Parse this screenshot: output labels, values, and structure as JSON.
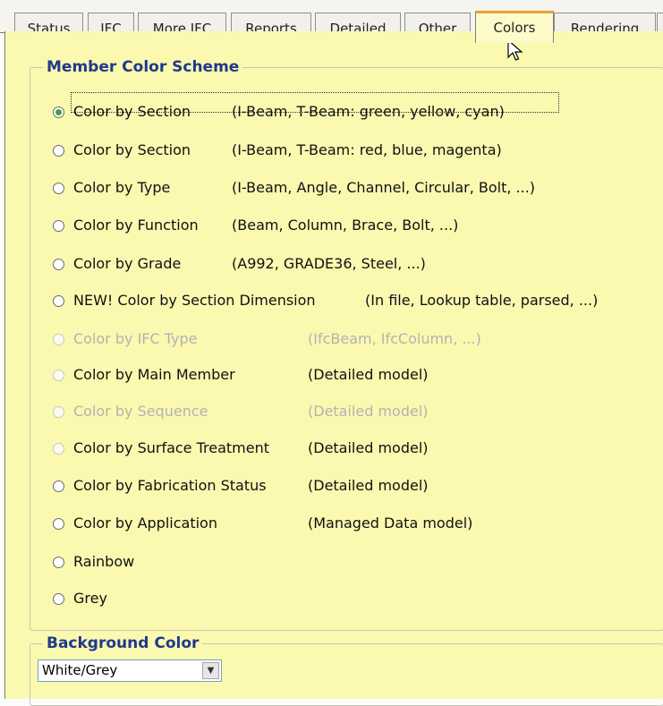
{
  "tabs": [
    {
      "label": "Status"
    },
    {
      "label": "IFC"
    },
    {
      "label": "More IFC"
    },
    {
      "label": "Reports"
    },
    {
      "label": "Detailed"
    },
    {
      "label": "Other"
    },
    {
      "label": "Colors",
      "active": true
    },
    {
      "label": "Rendering"
    }
  ],
  "member_scheme": {
    "title": "Member Color Scheme",
    "options": [
      {
        "label": "Color by Section",
        "desc": "(I-Beam, T-Beam:  green, yellow, cyan)",
        "checked": true,
        "enabled": true
      },
      {
        "label": "Color by Section",
        "desc": "(I-Beam, T-Beam:  red, blue, magenta)",
        "checked": false,
        "enabled": true
      },
      {
        "label": "Color by Type",
        "desc": "(I-Beam, Angle, Channel, Circular, Bolt, ...)",
        "checked": false,
        "enabled": true
      },
      {
        "label": "Color by Function",
        "desc": "(Beam, Column, Brace, Bolt, ...)",
        "checked": false,
        "enabled": true
      },
      {
        "label": "Color by Grade",
        "desc": "(A992, GRADE36, Steel, ...)",
        "checked": false,
        "enabled": true
      },
      {
        "label": "NEW!  Color by Section Dimension",
        "desc": "(In file, Lookup table, parsed, ...)",
        "checked": false,
        "enabled": true
      },
      {
        "label": "Color by IFC Type",
        "desc": "(IfcBeam, IfcColumn, ...)",
        "checked": false,
        "enabled": false
      },
      {
        "label": "Color by Main Member",
        "desc": "(Detailed model)",
        "checked": false,
        "enabled": true
      },
      {
        "label": "Color by Sequence",
        "desc": "(Detailed model)",
        "checked": false,
        "enabled": false
      },
      {
        "label": "Color by Surface Treatment",
        "desc": "(Detailed model)",
        "checked": false,
        "enabled": true
      },
      {
        "label": "Color by Fabrication Status",
        "desc": "(Detailed model)",
        "checked": false,
        "enabled": true
      },
      {
        "label": "Color by Application",
        "desc": "(Managed Data model)",
        "checked": false,
        "enabled": true
      },
      {
        "label": "Rainbow",
        "desc": "",
        "checked": false,
        "enabled": true
      },
      {
        "label": "Grey",
        "desc": "",
        "checked": false,
        "enabled": true
      }
    ]
  },
  "background_color": {
    "title": "Background Color",
    "selected": "White/Grey"
  },
  "colors": {
    "panel_bg": "#fbf8b0",
    "legend_text": "#1e3a8a",
    "active_tab_accent": "#e8a13c",
    "radio_checked": "#3ea43e"
  }
}
